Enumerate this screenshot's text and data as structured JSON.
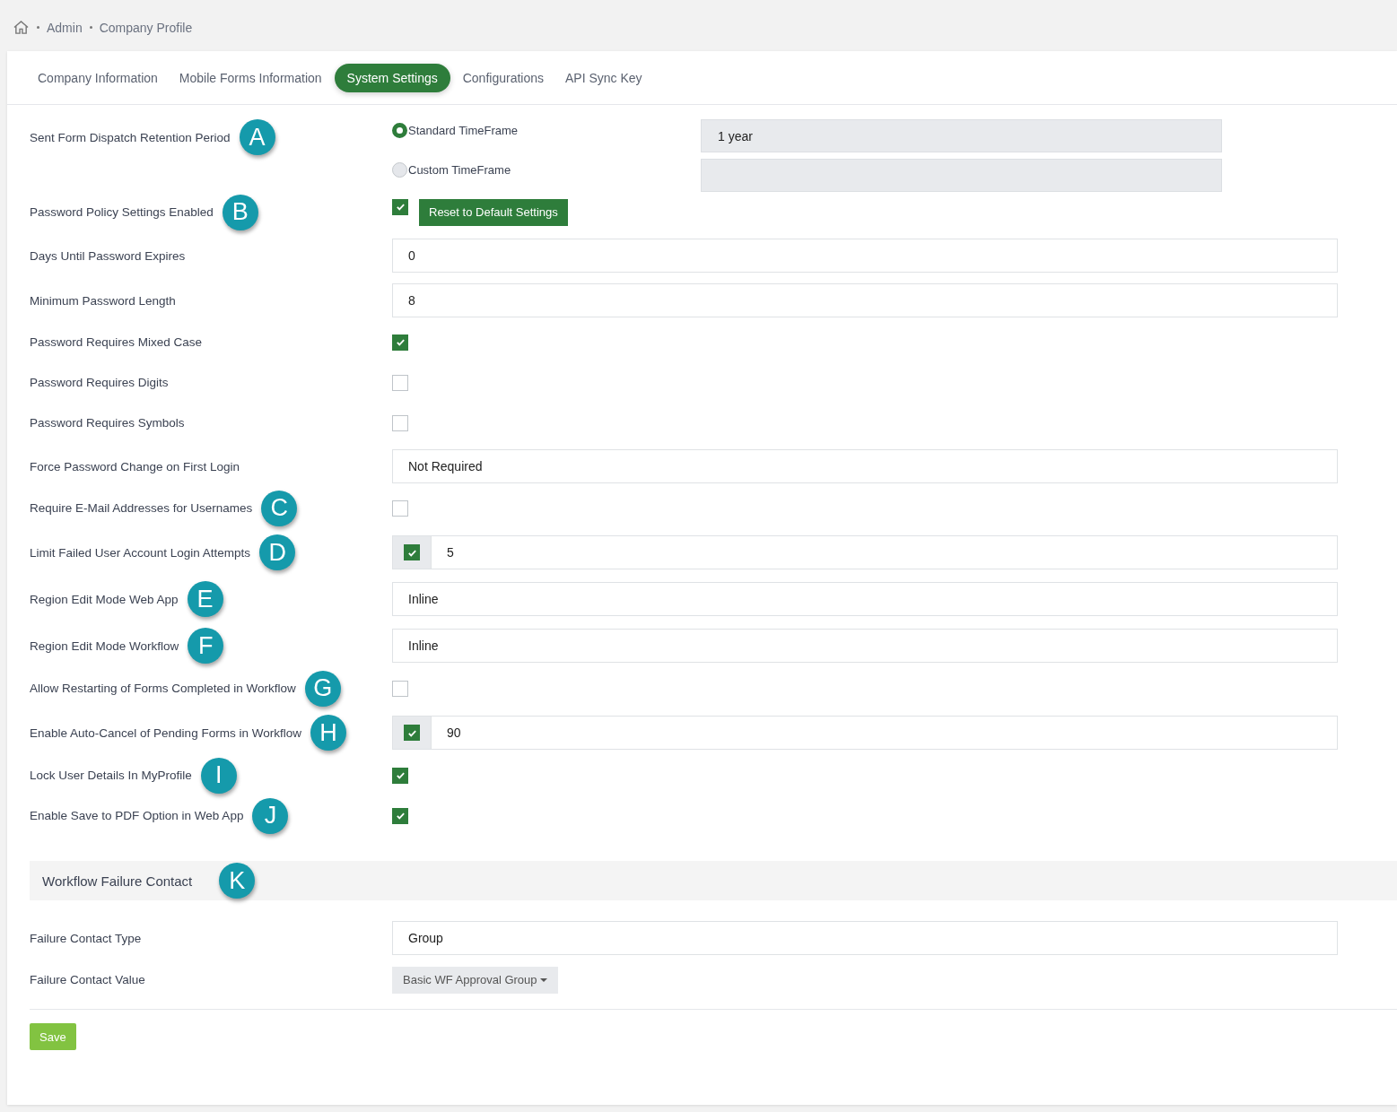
{
  "breadcrumb": [
    "Admin",
    "Company Profile"
  ],
  "tabs": [
    {
      "label": "Company Information",
      "selected": false
    },
    {
      "label": "Mobile Forms Information",
      "selected": false
    },
    {
      "label": "System Settings",
      "selected": true
    },
    {
      "label": "Configurations",
      "selected": false
    },
    {
      "label": "API Sync Key",
      "selected": false
    }
  ],
  "settings": [
    {
      "kind": "radio",
      "label": "Sent Form Dispatch Retention Period",
      "marker": "A",
      "options": [
        {
          "label": "Standard TimeFrame",
          "selected": true,
          "value": "1 year"
        },
        {
          "label": "Custom TimeFrame",
          "selected": false
        }
      ]
    },
    {
      "kind": "check_button",
      "label": "Password Policy Settings Enabled",
      "marker": "B",
      "checked": true,
      "button": "Reset to Default Settings"
    },
    {
      "kind": "field",
      "label": "Days Until Password Expires",
      "value": "0"
    },
    {
      "kind": "field",
      "label": "Minimum Password Length",
      "value": "8"
    },
    {
      "kind": "checkbox",
      "label": "Password Requires Mixed Case",
      "checked": true
    },
    {
      "kind": "checkbox",
      "label": "Password Requires Digits",
      "checked": false
    },
    {
      "kind": "checkbox",
      "label": "Password Requires Symbols",
      "checked": false
    },
    {
      "kind": "field",
      "label": "Force Password Change on First Login",
      "value": "Not Required"
    },
    {
      "kind": "checkbox",
      "label": "Require E-Mail Addresses for Usernames",
      "marker": "C",
      "checked": false
    },
    {
      "kind": "check_field",
      "label": "Limit Failed User Account Login Attempts",
      "marker": "D",
      "checked": true,
      "value": "5"
    },
    {
      "kind": "field",
      "label": "Region Edit Mode Web App",
      "marker": "E",
      "value": "Inline"
    },
    {
      "kind": "field",
      "label": "Region Edit Mode Workflow",
      "marker": "F",
      "value": "Inline"
    },
    {
      "kind": "checkbox",
      "label": "Allow Restarting of Forms Completed in Workflow",
      "marker": "G",
      "checked": false
    },
    {
      "kind": "check_field",
      "label": "Enable Auto-Cancel of Pending Forms in Workflow",
      "marker": "H",
      "checked": true,
      "value": "90"
    },
    {
      "kind": "checkbox",
      "label": "Lock User Details In MyProfile",
      "marker": "I",
      "checked": true
    },
    {
      "kind": "checkbox",
      "label": "Enable Save to PDF Option in Web App",
      "marker": "J",
      "checked": true
    }
  ],
  "section": {
    "title": "Workflow Failure Contact",
    "marker": "K",
    "rows": [
      {
        "kind": "field",
        "label": "Failure Contact Type",
        "value": "Group"
      },
      {
        "kind": "dropdown",
        "label": "Failure Contact Value",
        "value": "Basic WF Approval Group"
      }
    ]
  },
  "save_button": "Save"
}
